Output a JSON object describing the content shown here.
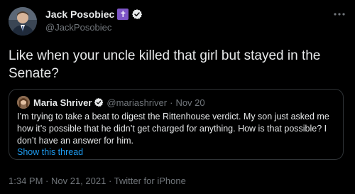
{
  "author": {
    "display_name": "Jack Posobiec",
    "badge_glyph": "✝",
    "handle": "@JackPosobiec",
    "verified": true
  },
  "tweet": {
    "text": "Like when your uncle killed that girl but stayed in the Senate?"
  },
  "quote": {
    "display_name": "Maria Shriver",
    "handle": "@mariashriver",
    "separator": "·",
    "date": "Nov 20",
    "text": "I’m trying to take a beat to digest the Rittenhouse verdict. My son just asked me how it’s possible that he didn’t get charged for anything. How is that possible? I don’t have an answer for him.",
    "show_thread": "Show this thread"
  },
  "meta": {
    "time": "1:34 PM",
    "sep1": " · ",
    "date": "Nov 21, 2021",
    "sep2": " · ",
    "source": "Twitter for iPhone"
  },
  "colors": {
    "background": "#000000",
    "text": "#e7e9ea",
    "muted": "#71767b",
    "link": "#1d9bf0",
    "badge": "#7d55c7",
    "border": "#2f3336"
  },
  "icons": {
    "more": "more-horizontal-icon",
    "verified": "verified-badge-icon",
    "cross": "cross-badge-icon"
  }
}
